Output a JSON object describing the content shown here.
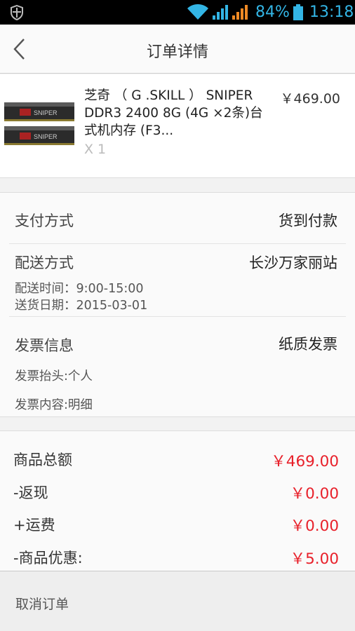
{
  "status_bar": {
    "battery_percent": "84%",
    "time": "13:18",
    "icons": [
      "shield-icon",
      "wifi-icon",
      "signal-icon",
      "signal-icon",
      "battery-icon"
    ],
    "accent_color": "#33b5e5"
  },
  "header": {
    "title": "订单详情",
    "back_icon": "chevron-left-icon"
  },
  "product": {
    "name": "芝奇 （ G .SKILL ） SNIPER DDR3 2400 8G (4G ×2条)台式机内存 (F3...",
    "quantity": "X 1",
    "price": "￥469.00"
  },
  "payment": {
    "label": "支付方式",
    "value": "货到付款"
  },
  "delivery": {
    "label": "配送方式",
    "value": "长沙万家丽站",
    "time": "配送时间：9:00-15:00",
    "date": "送货日期：2015-03-01"
  },
  "invoice": {
    "label": "发票信息",
    "value": "纸质发票",
    "title": "发票抬头:个人",
    "content": "发票内容:明细"
  },
  "totals": {
    "price_color": "#e8202a",
    "items": [
      {
        "label": "商品总额",
        "value": "￥469.00"
      },
      {
        "label": "-返现",
        "value": "￥0.00"
      },
      {
        "label": "+运费",
        "value": "￥0.00"
      },
      {
        "label": "-商品优惠:",
        "value": "￥5.00"
      }
    ]
  },
  "footer": {
    "cancel_label": "取消订单"
  }
}
